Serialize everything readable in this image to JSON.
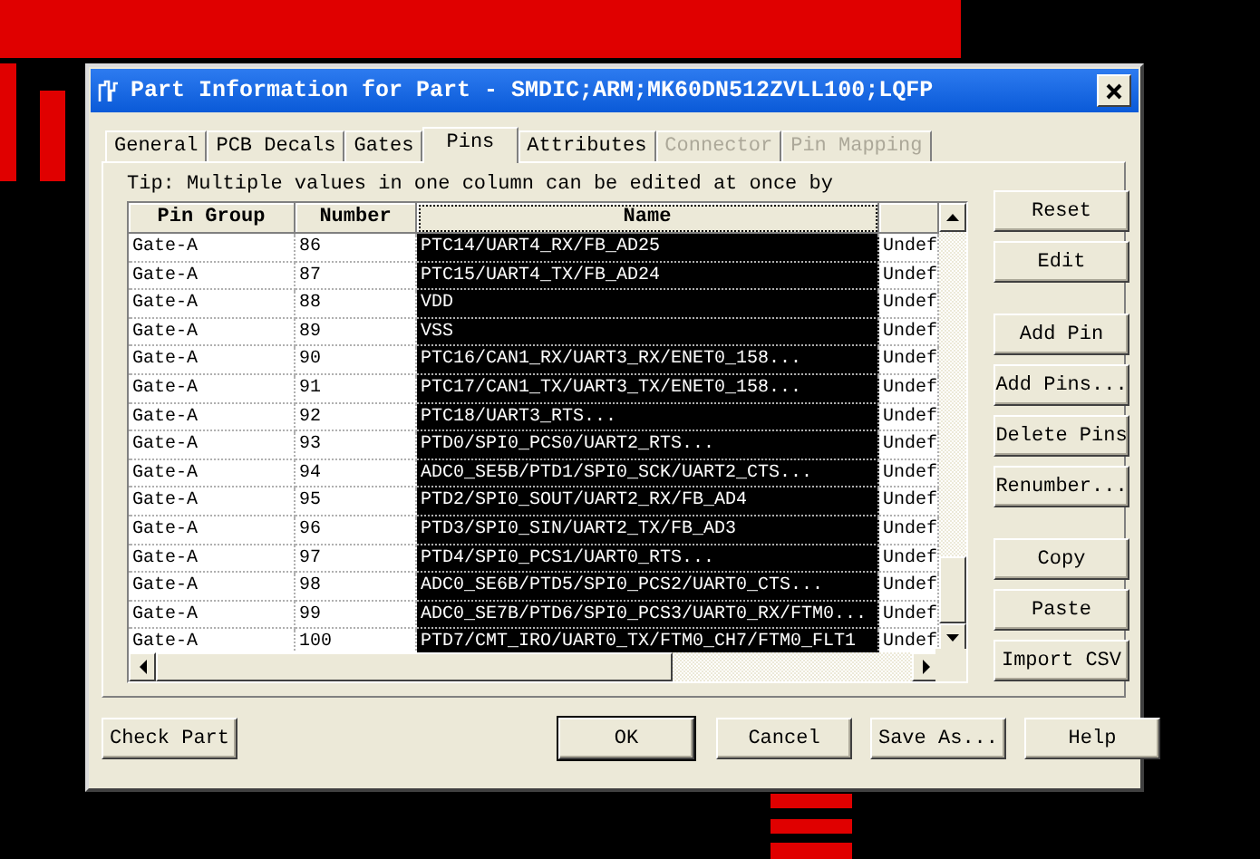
{
  "window": {
    "title": "Part Information for Part - SMDIC;ARM;MK60DN512ZVLL100;LQFP"
  },
  "tabs": [
    {
      "label": "General",
      "selected": false,
      "disabled": false
    },
    {
      "label": "PCB Decals",
      "selected": false,
      "disabled": false
    },
    {
      "label": "Gates",
      "selected": false,
      "disabled": false
    },
    {
      "label": "Pins",
      "selected": true,
      "disabled": false
    },
    {
      "label": "Attributes",
      "selected": false,
      "disabled": false
    },
    {
      "label": "Connector",
      "selected": false,
      "disabled": true
    },
    {
      "label": "Pin Mapping",
      "selected": false,
      "disabled": true
    }
  ],
  "tip": "Tip: Multiple values in one column can be edited at once by",
  "table": {
    "columns": [
      {
        "label": "Pin Group",
        "selected": false
      },
      {
        "label": "Number",
        "selected": false
      },
      {
        "label": "Name",
        "selected": true
      },
      {
        "selected": false
      }
    ],
    "rows": [
      [
        "Gate-A",
        "86",
        "PTC14/UART4_RX/FB_AD25",
        "Undef"
      ],
      [
        "Gate-A",
        "87",
        "PTC15/UART4_TX/FB_AD24",
        "Undef"
      ],
      [
        "Gate-A",
        "88",
        "VDD",
        "Undef"
      ],
      [
        "Gate-A",
        "89",
        "VSS",
        "Undef"
      ],
      [
        "Gate-A",
        "90",
        "PTC16/CAN1_RX/UART3_RX/ENET0_158...",
        "Undef"
      ],
      [
        "Gate-A",
        "91",
        "PTC17/CAN1_TX/UART3_TX/ENET0_158...",
        "Undef"
      ],
      [
        "Gate-A",
        "92",
        "PTC18/UART3_RTS...",
        "Undef"
      ],
      [
        "Gate-A",
        "93",
        "PTD0/SPI0_PCS0/UART2_RTS...",
        "Undef"
      ],
      [
        "Gate-A",
        "94",
        "ADC0_SE5B/PTD1/SPI0_SCK/UART2_CTS...",
        "Undef"
      ],
      [
        "Gate-A",
        "95",
        "PTD2/SPI0_SOUT/UART2_RX/FB_AD4",
        "Undef"
      ],
      [
        "Gate-A",
        "96",
        "PTD3/SPI0_SIN/UART2_TX/FB_AD3",
        "Undef"
      ],
      [
        "Gate-A",
        "97",
        "PTD4/SPI0_PCS1/UART0_RTS...",
        "Undef"
      ],
      [
        "Gate-A",
        "98",
        "ADC0_SE6B/PTD5/SPI0_PCS2/UART0_CTS...",
        "Undef"
      ],
      [
        "Gate-A",
        "99",
        "ADC0_SE7B/PTD6/SPI0_PCS3/UART0_RX/FTM0...",
        "Undef"
      ],
      [
        "Gate-A",
        "100",
        "PTD7/CMT_IRO/UART0_TX/FTM0_CH7/FTM0_FLT1",
        "Undef"
      ]
    ]
  },
  "side_button_groups": [
    [
      "Reset",
      "Edit"
    ],
    [
      "Add Pin",
      "Add Pins...",
      "Delete Pins",
      "Renumber..."
    ],
    [
      "Copy",
      "Paste",
      "Import CSV"
    ]
  ],
  "bottom_buttons": [
    {
      "label": "Check Part",
      "default": false
    },
    {
      "label": "OK",
      "default": true
    },
    {
      "label": "Cancel",
      "default": false
    },
    {
      "label": "Save As...",
      "default": false
    },
    {
      "label": "Help",
      "default": false
    }
  ]
}
